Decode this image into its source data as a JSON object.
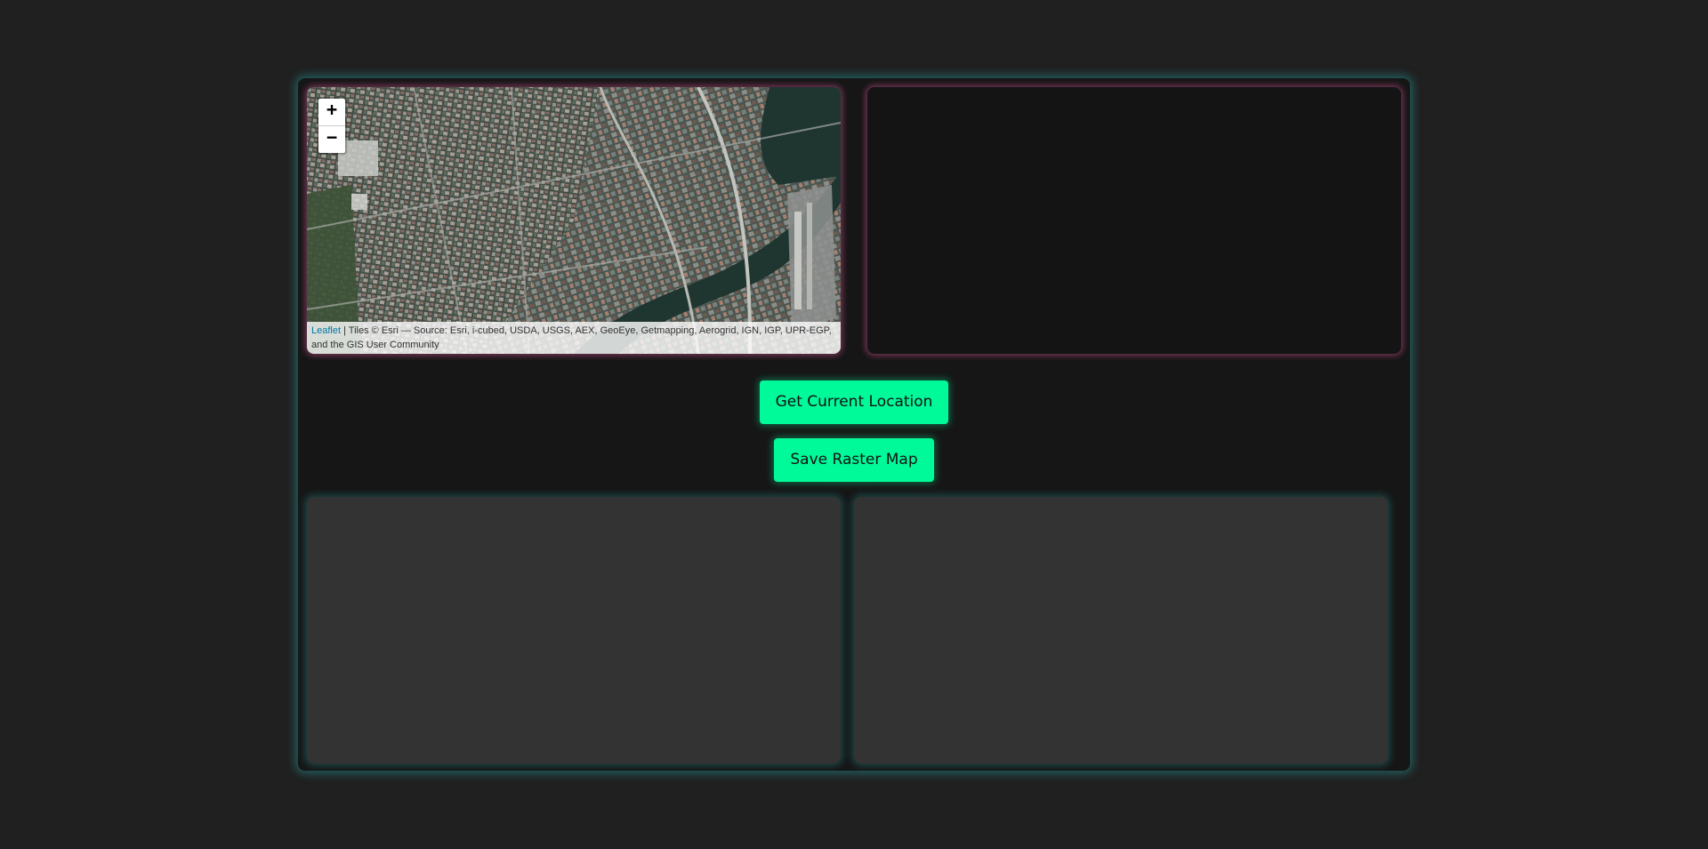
{
  "map": {
    "zoom_in_label": "+",
    "zoom_out_label": "−",
    "attribution_link": "Leaflet",
    "attribution_text": " | Tiles © Esri — Source: Esri, i-cubed, USDA, USGS, AEX, GeoEye, Getmapping, Aerogrid, IGN, IGP, UPR-EGP, and the GIS User Community"
  },
  "buttons": {
    "location_label": "Get Current Location",
    "save_label": "Save Raster Map"
  },
  "colors": {
    "accent": "#00fa9a",
    "frame_glow": "#249696",
    "panel_glow": "#c8508c",
    "background": "#202020"
  }
}
